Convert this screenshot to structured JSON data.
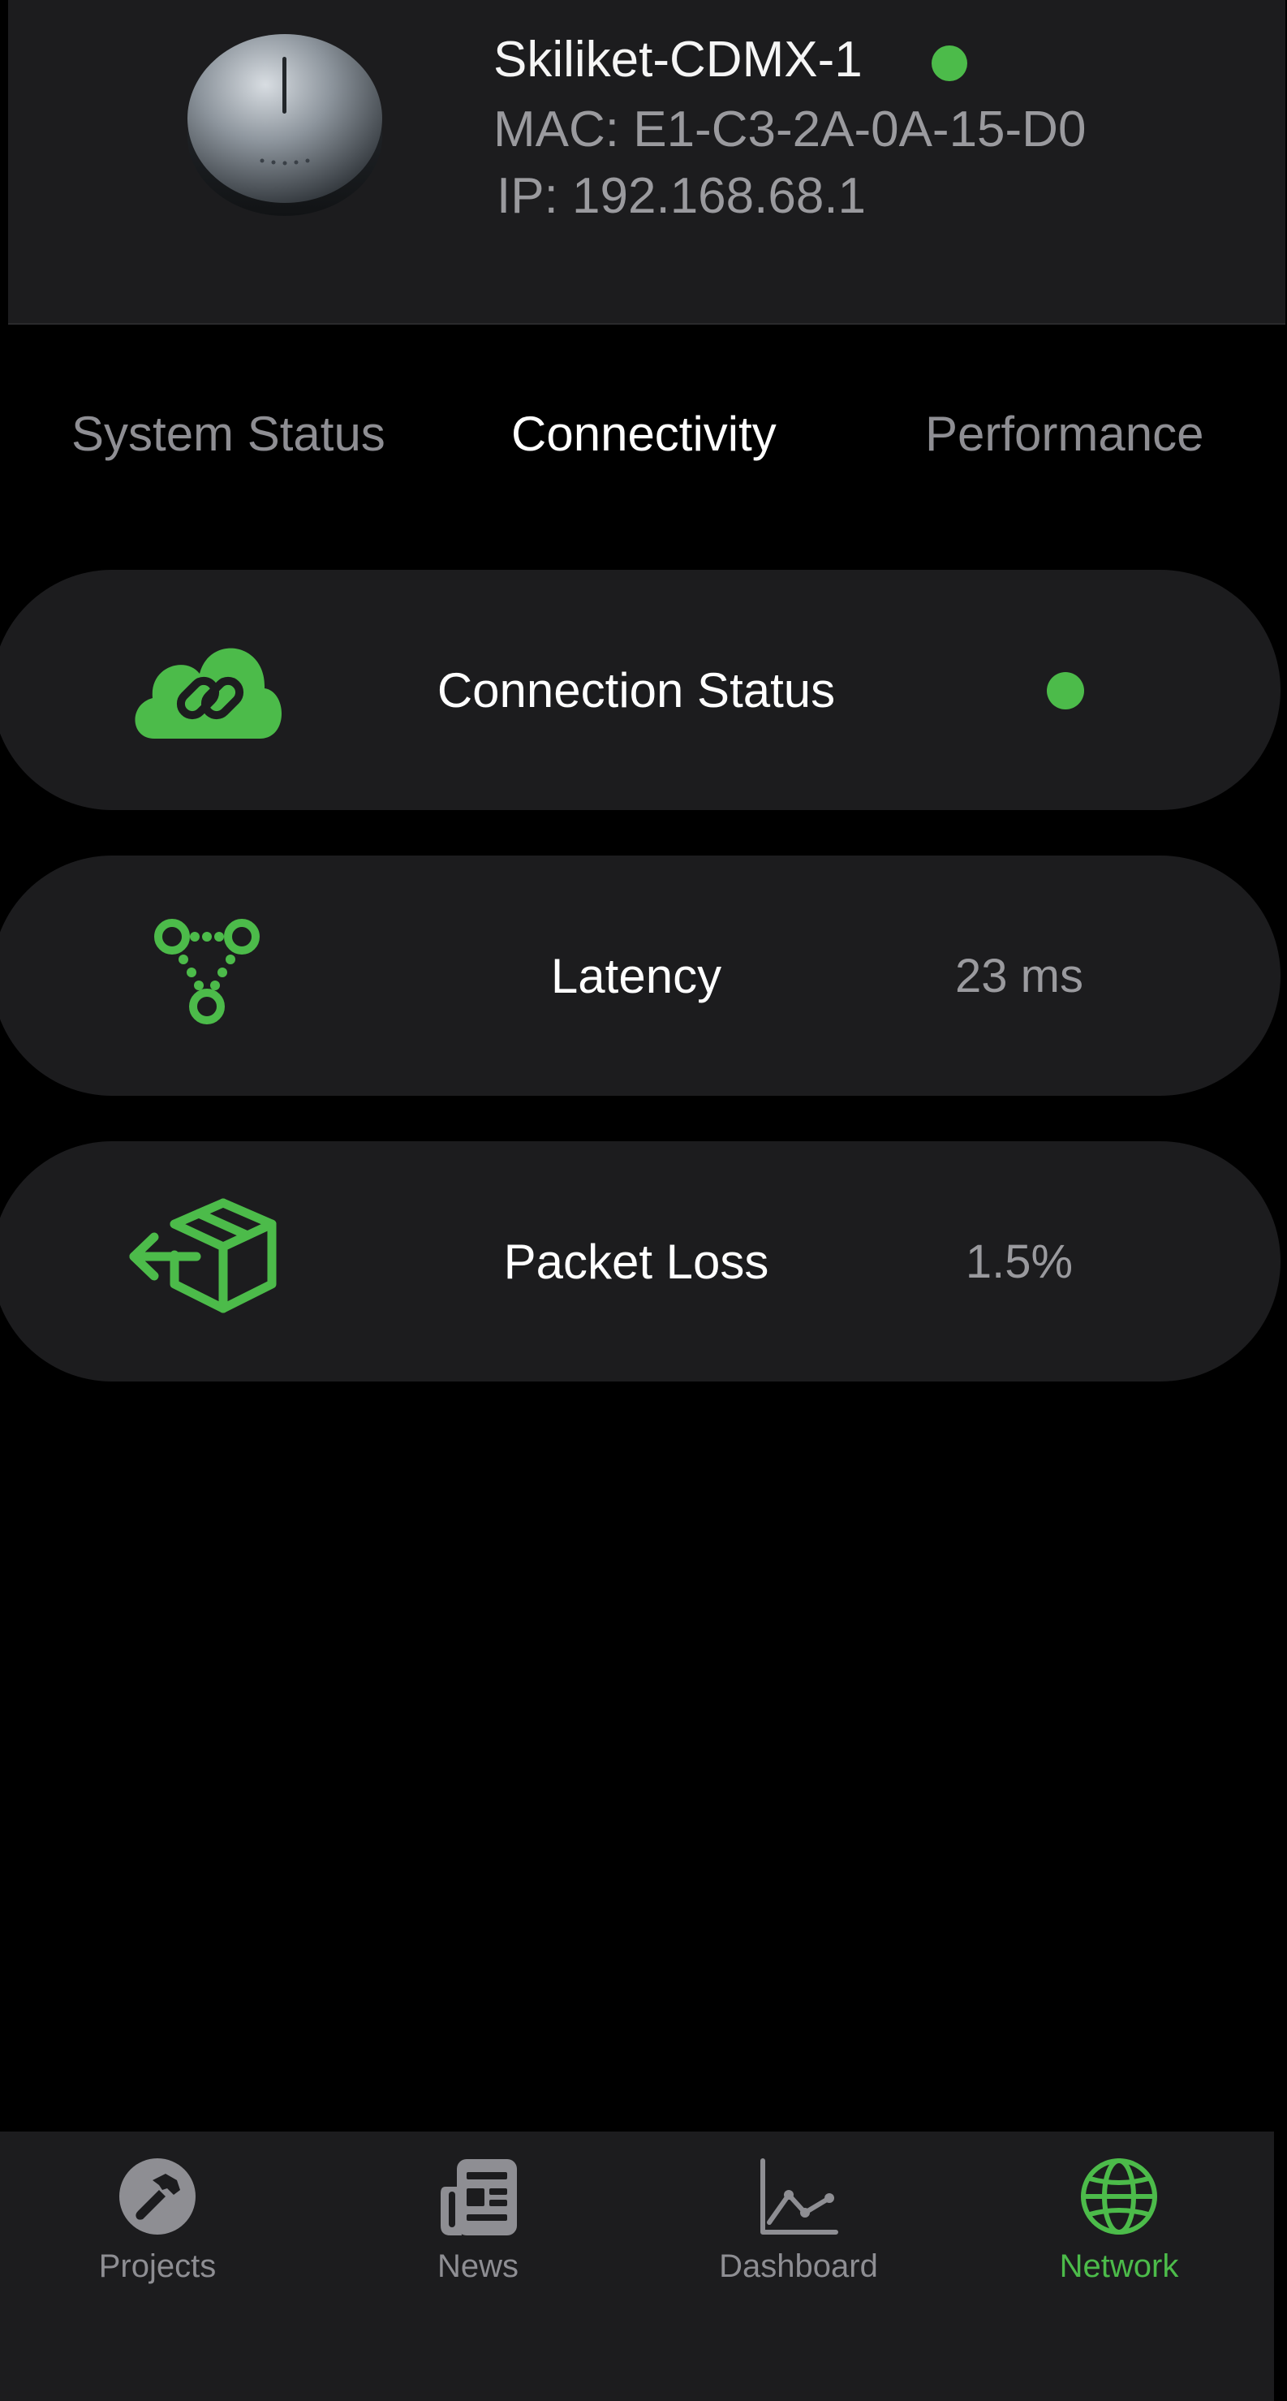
{
  "colors": {
    "accent": "#4cbb4a",
    "online": "#4cbb4a",
    "card_bg": "#1c1c1e",
    "muted_text": "#9a9a9e"
  },
  "device": {
    "name": "Skiliket-CDMX-1",
    "mac": "MAC: E1-C3-2A-0A-15-D0",
    "ip": "IP: 192.168.68.1",
    "status": "online",
    "image_icon": "round-device-icon"
  },
  "tabs": [
    {
      "label": "System Status",
      "active": false
    },
    {
      "label": "Connectivity",
      "active": true
    },
    {
      "label": "Performance",
      "active": false
    }
  ],
  "metrics": [
    {
      "label": "Connection Status",
      "icon": "cloud-link-icon",
      "status": "online"
    },
    {
      "label": "Latency",
      "icon": "network-nodes-icon",
      "value": "23 ms"
    },
    {
      "label": "Packet Loss",
      "icon": "box-arrow-icon",
      "value": "1.5%"
    }
  ],
  "nav": [
    {
      "label": "Projects",
      "icon": "hammer-icon",
      "active": false
    },
    {
      "label": "News",
      "icon": "newspaper-icon",
      "active": false
    },
    {
      "label": "Dashboard",
      "icon": "chart-line-icon",
      "active": false
    },
    {
      "label": "Network",
      "icon": "globe-icon",
      "active": true
    }
  ]
}
